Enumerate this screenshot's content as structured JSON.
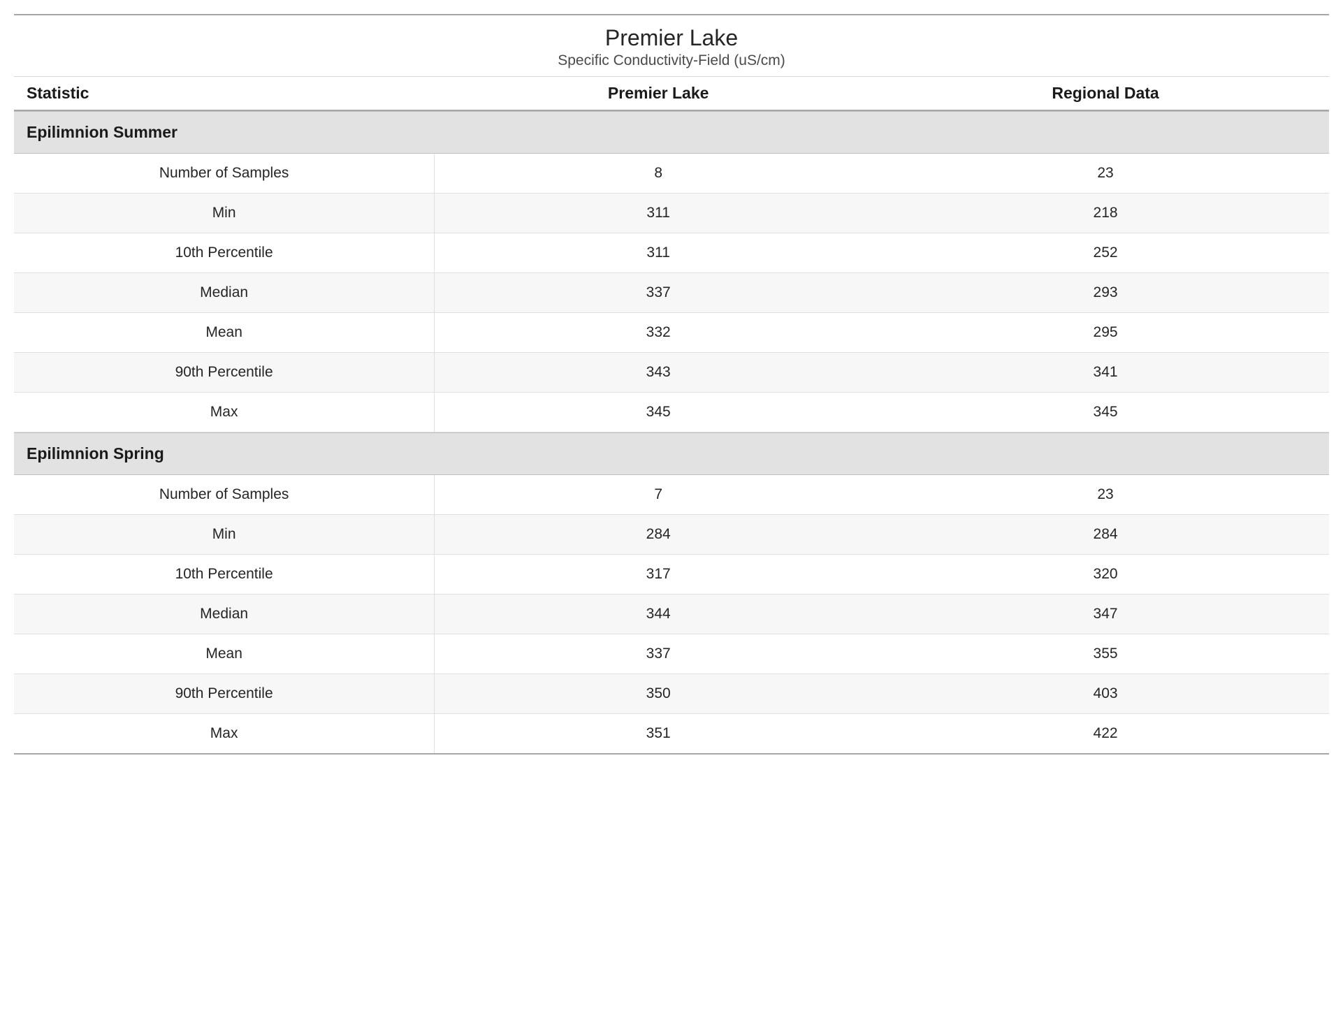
{
  "title": "Premier Lake",
  "subtitle": "Specific Conductivity-Field (uS/cm)",
  "columns": [
    "Statistic",
    "Premier Lake",
    "Regional Data"
  ],
  "sections": [
    {
      "name": "Epilimnion Summer",
      "rows": [
        {
          "stat": "Number of Samples",
          "lake": "8",
          "regional": "23"
        },
        {
          "stat": "Min",
          "lake": "311",
          "regional": "218"
        },
        {
          "stat": "10th Percentile",
          "lake": "311",
          "regional": "252"
        },
        {
          "stat": "Median",
          "lake": "337",
          "regional": "293"
        },
        {
          "stat": "Mean",
          "lake": "332",
          "regional": "295"
        },
        {
          "stat": "90th Percentile",
          "lake": "343",
          "regional": "341"
        },
        {
          "stat": "Max",
          "lake": "345",
          "regional": "345"
        }
      ]
    },
    {
      "name": "Epilimnion Spring",
      "rows": [
        {
          "stat": "Number of Samples",
          "lake": "7",
          "regional": "23"
        },
        {
          "stat": "Min",
          "lake": "284",
          "regional": "284"
        },
        {
          "stat": "10th Percentile",
          "lake": "317",
          "regional": "320"
        },
        {
          "stat": "Median",
          "lake": "344",
          "regional": "347"
        },
        {
          "stat": "Mean",
          "lake": "337",
          "regional": "355"
        },
        {
          "stat": "90th Percentile",
          "lake": "350",
          "regional": "403"
        },
        {
          "stat": "Max",
          "lake": "351",
          "regional": "422"
        }
      ]
    }
  ]
}
